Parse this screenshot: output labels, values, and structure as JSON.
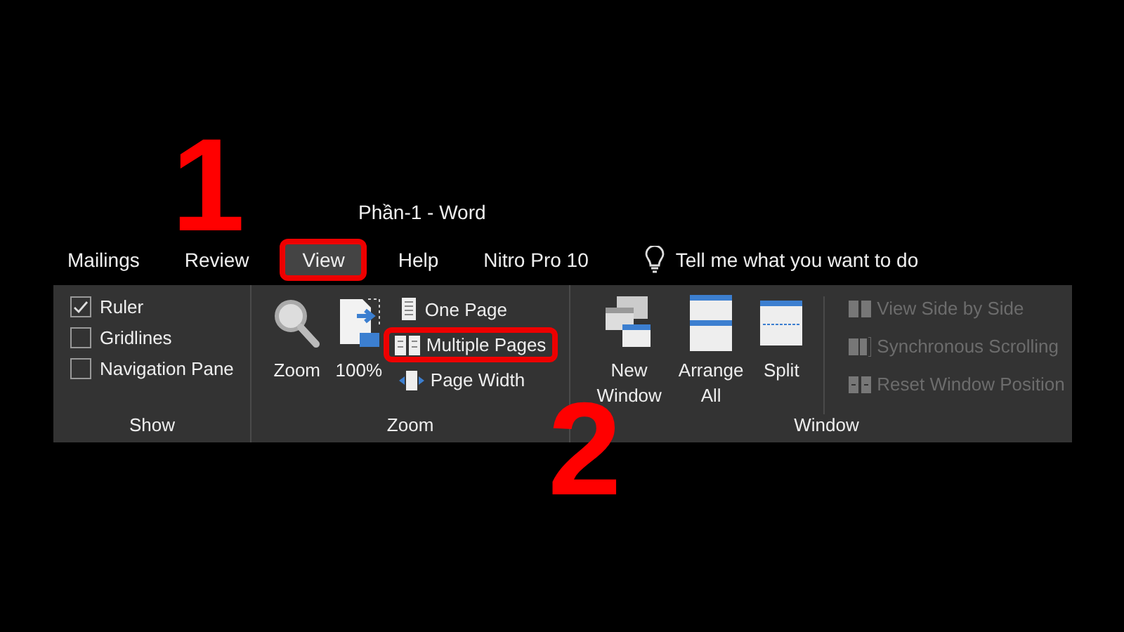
{
  "window": {
    "title": "Phần-1  -  Word"
  },
  "tabs": [
    {
      "label": "Mailings",
      "selected": false,
      "highlighted": false
    },
    {
      "label": "Review",
      "selected": false,
      "highlighted": false
    },
    {
      "label": "View",
      "selected": true,
      "highlighted": true
    },
    {
      "label": "Help",
      "selected": false,
      "highlighted": false
    },
    {
      "label": "Nitro Pro 10",
      "selected": false,
      "highlighted": false
    }
  ],
  "tell_me": {
    "placeholder": "Tell me what you want to do"
  },
  "ribbon": {
    "groups": [
      {
        "name": "Show",
        "kind": "checks",
        "items": [
          {
            "label": "Ruler",
            "checked": true
          },
          {
            "label": "Gridlines",
            "checked": false
          },
          {
            "label": "Navigation Pane",
            "checked": false
          }
        ]
      },
      {
        "name": "Zoom",
        "kind": "zoom",
        "big": [
          {
            "label": "Zoom"
          },
          {
            "label": "100%"
          }
        ],
        "items": [
          {
            "label": "One Page",
            "highlighted": false
          },
          {
            "label": "Multiple Pages",
            "highlighted": true
          },
          {
            "label": "Page Width",
            "highlighted": false
          }
        ]
      },
      {
        "name": "Window",
        "kind": "window",
        "big": [
          {
            "label": "New Window"
          },
          {
            "label": "Arrange All"
          },
          {
            "label": "Split"
          }
        ],
        "items": [
          {
            "label": "View Side by Side",
            "disabled": true
          },
          {
            "label": "Synchronous Scrolling",
            "disabled": true
          },
          {
            "label": "Reset Window Position",
            "disabled": true
          }
        ]
      }
    ]
  },
  "annotations": [
    {
      "label": "1"
    },
    {
      "label": "2"
    }
  ]
}
